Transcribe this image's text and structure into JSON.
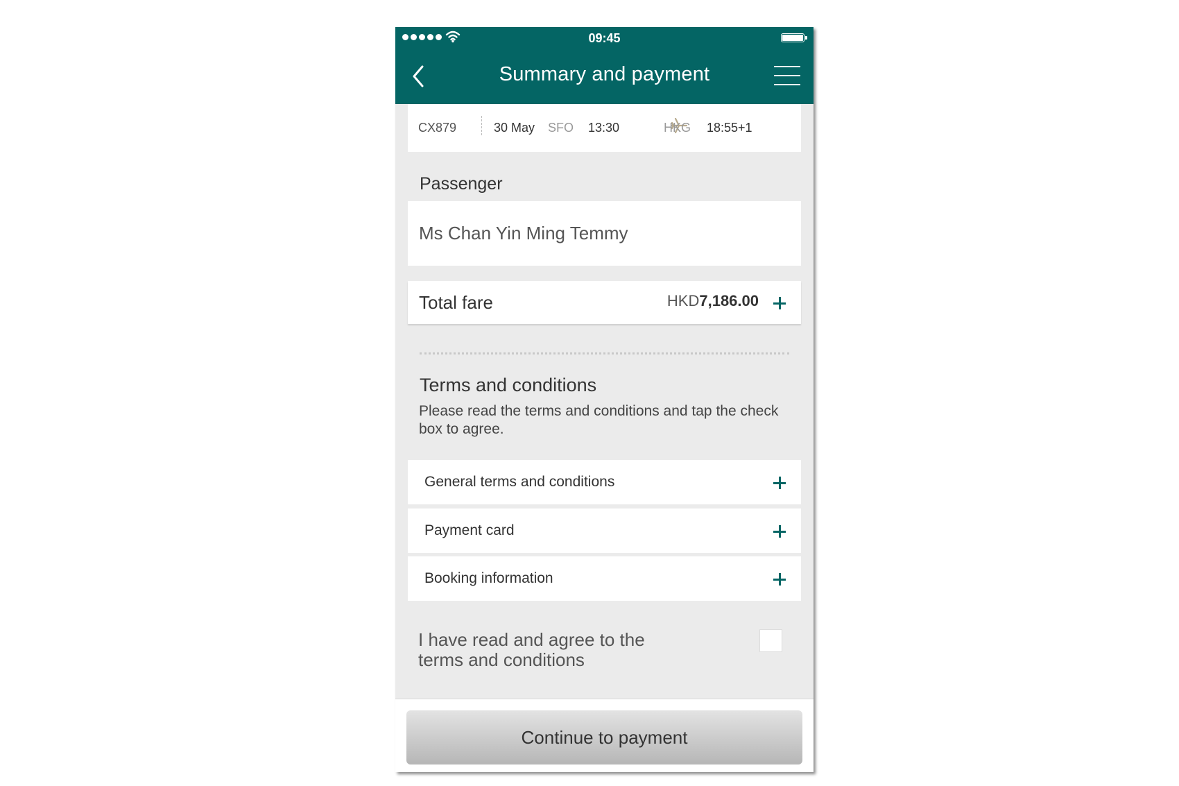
{
  "status_bar": {
    "time": "09:45"
  },
  "header": {
    "title": "Summary and payment"
  },
  "flight": {
    "number": "CX879",
    "date": "30 May",
    "origin": "SFO",
    "depart_time": "13:30",
    "destination": "HKG",
    "arrive_time": "18:55+1"
  },
  "passenger": {
    "section_label": "Passenger",
    "name": "Ms Chan Yin Ming Temmy"
  },
  "fare": {
    "label": "Total fare",
    "currency": "HKD",
    "amount": "7,186.00"
  },
  "terms": {
    "title": "Terms and conditions",
    "description": "Please read the terms and conditions and tap the check box to agree.",
    "sections": [
      {
        "label": "General terms and conditions"
      },
      {
        "label": "Payment card"
      },
      {
        "label": "Booking information"
      }
    ],
    "agree_text": "I have read and agree to the terms and conditions",
    "agreed": false
  },
  "footer": {
    "continue_label": "Continue to payment"
  },
  "colors": {
    "brand": "#046564",
    "plane_icon": "#b8ab8e"
  }
}
